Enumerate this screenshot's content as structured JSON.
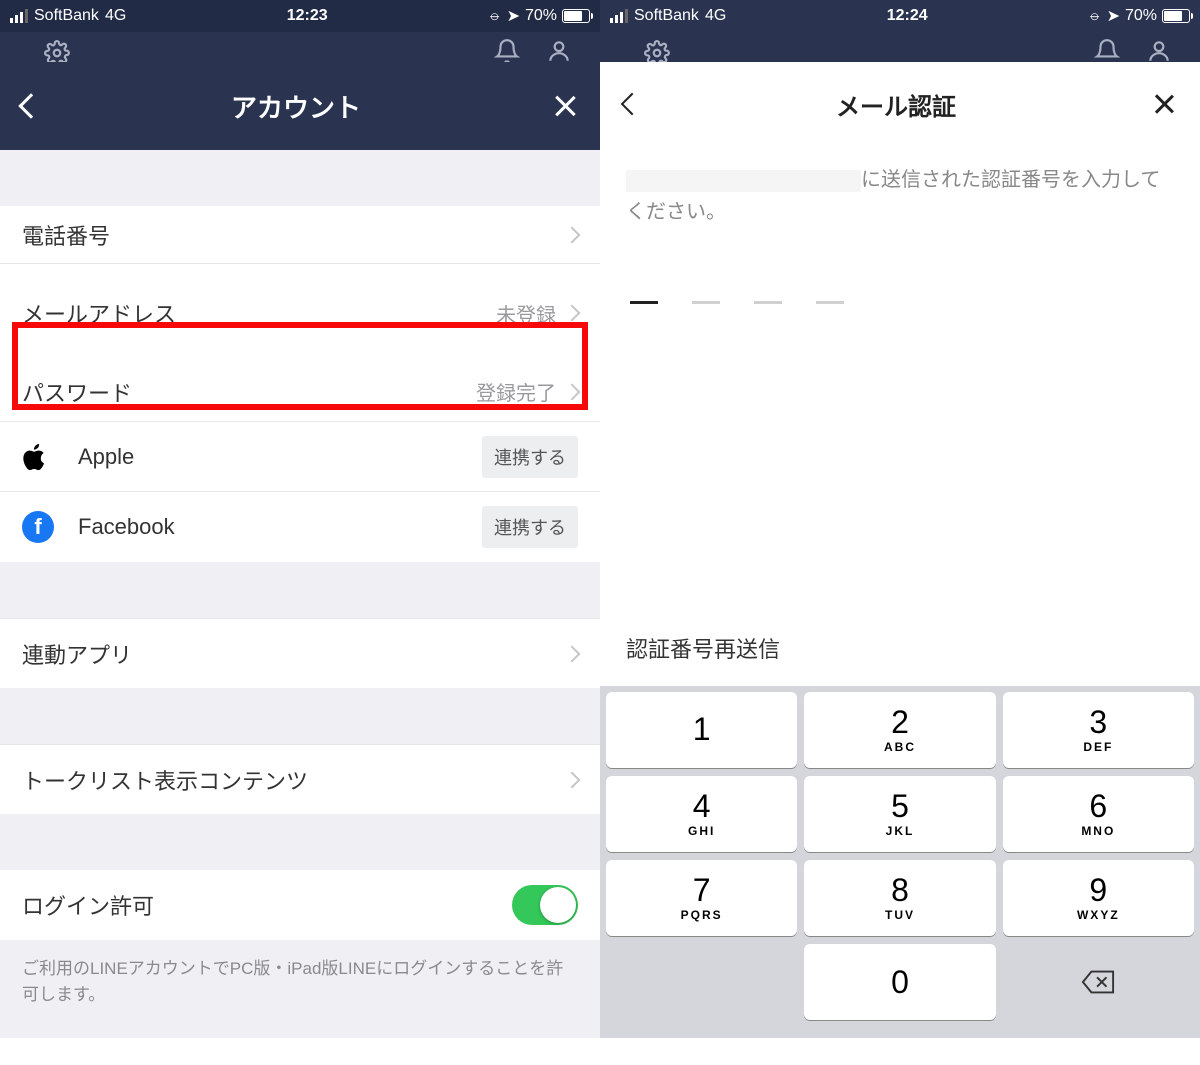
{
  "left": {
    "status": {
      "carrier": "SoftBank",
      "network": "4G",
      "time": "12:23",
      "battery": "70%"
    },
    "title": "アカウント",
    "rows": {
      "phone": {
        "label": "電話番号",
        "value": ""
      },
      "email": {
        "label": "メールアドレス",
        "value": "未登録"
      },
      "password": {
        "label": "パスワード",
        "value": "登録完了"
      },
      "apple": {
        "label": "Apple",
        "button": "連携する"
      },
      "facebook": {
        "label": "Facebook",
        "button": "連携する"
      },
      "linkedApps": {
        "label": "連動アプリ"
      },
      "talklist": {
        "label": "トークリスト表示コンテンツ"
      },
      "loginAllow": {
        "label": "ログイン許可",
        "toggle": true
      }
    },
    "footer": "ご利用のLINEアカウントでPC版・iPad版LINEにログインすることを許可します。"
  },
  "right": {
    "status": {
      "carrier": "SoftBank",
      "network": "4G",
      "time": "12:24",
      "battery": "70%"
    },
    "title": "メール認証",
    "instructionSuffix": "に送信された認証番号を入力してください。",
    "resend": "認証番号再送信",
    "keypad": [
      [
        {
          "d": "1",
          "l": ""
        },
        {
          "d": "2",
          "l": "ABC"
        },
        {
          "d": "3",
          "l": "DEF"
        }
      ],
      [
        {
          "d": "4",
          "l": "GHI"
        },
        {
          "d": "5",
          "l": "JKL"
        },
        {
          "d": "6",
          "l": "MNO"
        }
      ],
      [
        {
          "d": "7",
          "l": "PQRS"
        },
        {
          "d": "8",
          "l": "TUV"
        },
        {
          "d": "9",
          "l": "WXYZ"
        }
      ]
    ],
    "zero": "0"
  }
}
